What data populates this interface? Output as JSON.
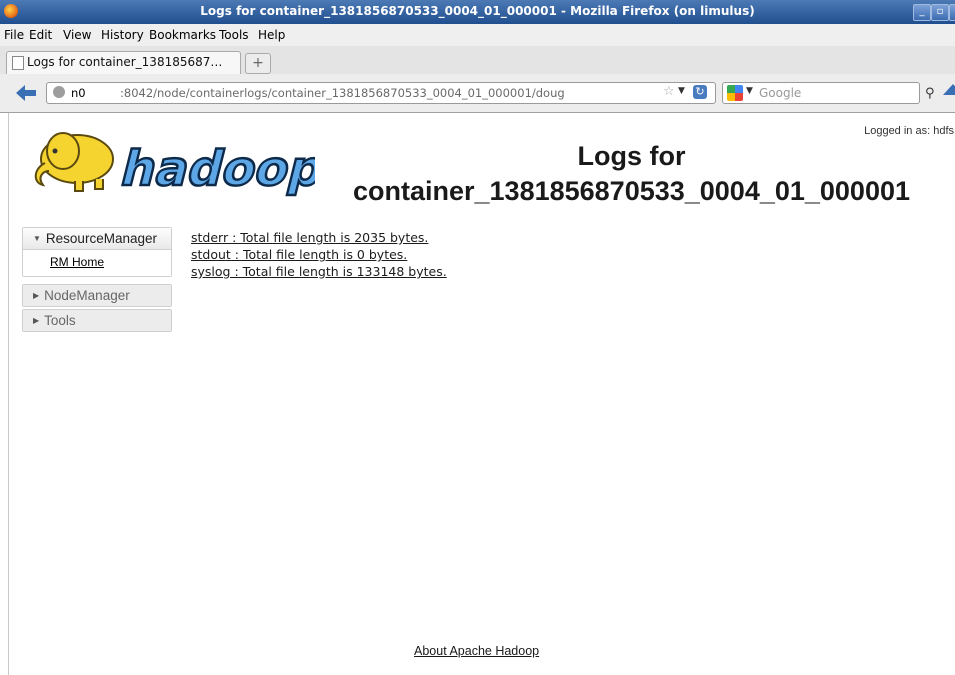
{
  "window": {
    "title": "Logs for container_1381856870533_0004_01_000001 - Mozilla Firefox (on limulus)",
    "minimize_label": "_",
    "maximize_label": "▫",
    "close_label": "x"
  },
  "menu": {
    "items": [
      {
        "label": "File"
      },
      {
        "label": "Edit"
      },
      {
        "label": "View"
      },
      {
        "label": "History"
      },
      {
        "label": "Bookmarks"
      },
      {
        "label": "Tools"
      },
      {
        "label": "Help"
      }
    ]
  },
  "tabs": {
    "active_tab": "Logs for container_138185687…",
    "new_tab_label": "+"
  },
  "navbar": {
    "url_host": "n0",
    "url_rest": ":8042/node/containerlogs/container_1381856870533_0004_01_000001/doug",
    "search_placeholder": "Google",
    "icons": {
      "back": "back-arrow-icon",
      "site": "globe-icon",
      "bookmark": "star-icon",
      "reload": "reload-icon",
      "search_engine": "google-icon",
      "binoculars": "binoculars-icon",
      "home": "home-icon"
    }
  },
  "page": {
    "logged_in": "Logged in as: hdfs",
    "title": "Logs for container_1381856870533_0004_01_000001",
    "logo_text": "hadoop",
    "log_files": [
      {
        "label": "stderr : Total file length is 2035 bytes."
      },
      {
        "label": "stdout : Total file length is 0 bytes."
      },
      {
        "label": "syslog : Total file length is 133148 bytes."
      }
    ],
    "footer_link": "About Apache Hadoop"
  },
  "sidenav": {
    "groups": [
      {
        "label": "ResourceManager",
        "expanded": true,
        "items": [
          "RM Home"
        ]
      },
      {
        "label": "NodeManager",
        "expanded": false
      },
      {
        "label": "Tools",
        "expanded": false
      }
    ]
  },
  "colors": {
    "titlebar": "#2d5c9e",
    "logo_blue": "#5ea7e6",
    "logo_yellow": "#f5d430"
  }
}
